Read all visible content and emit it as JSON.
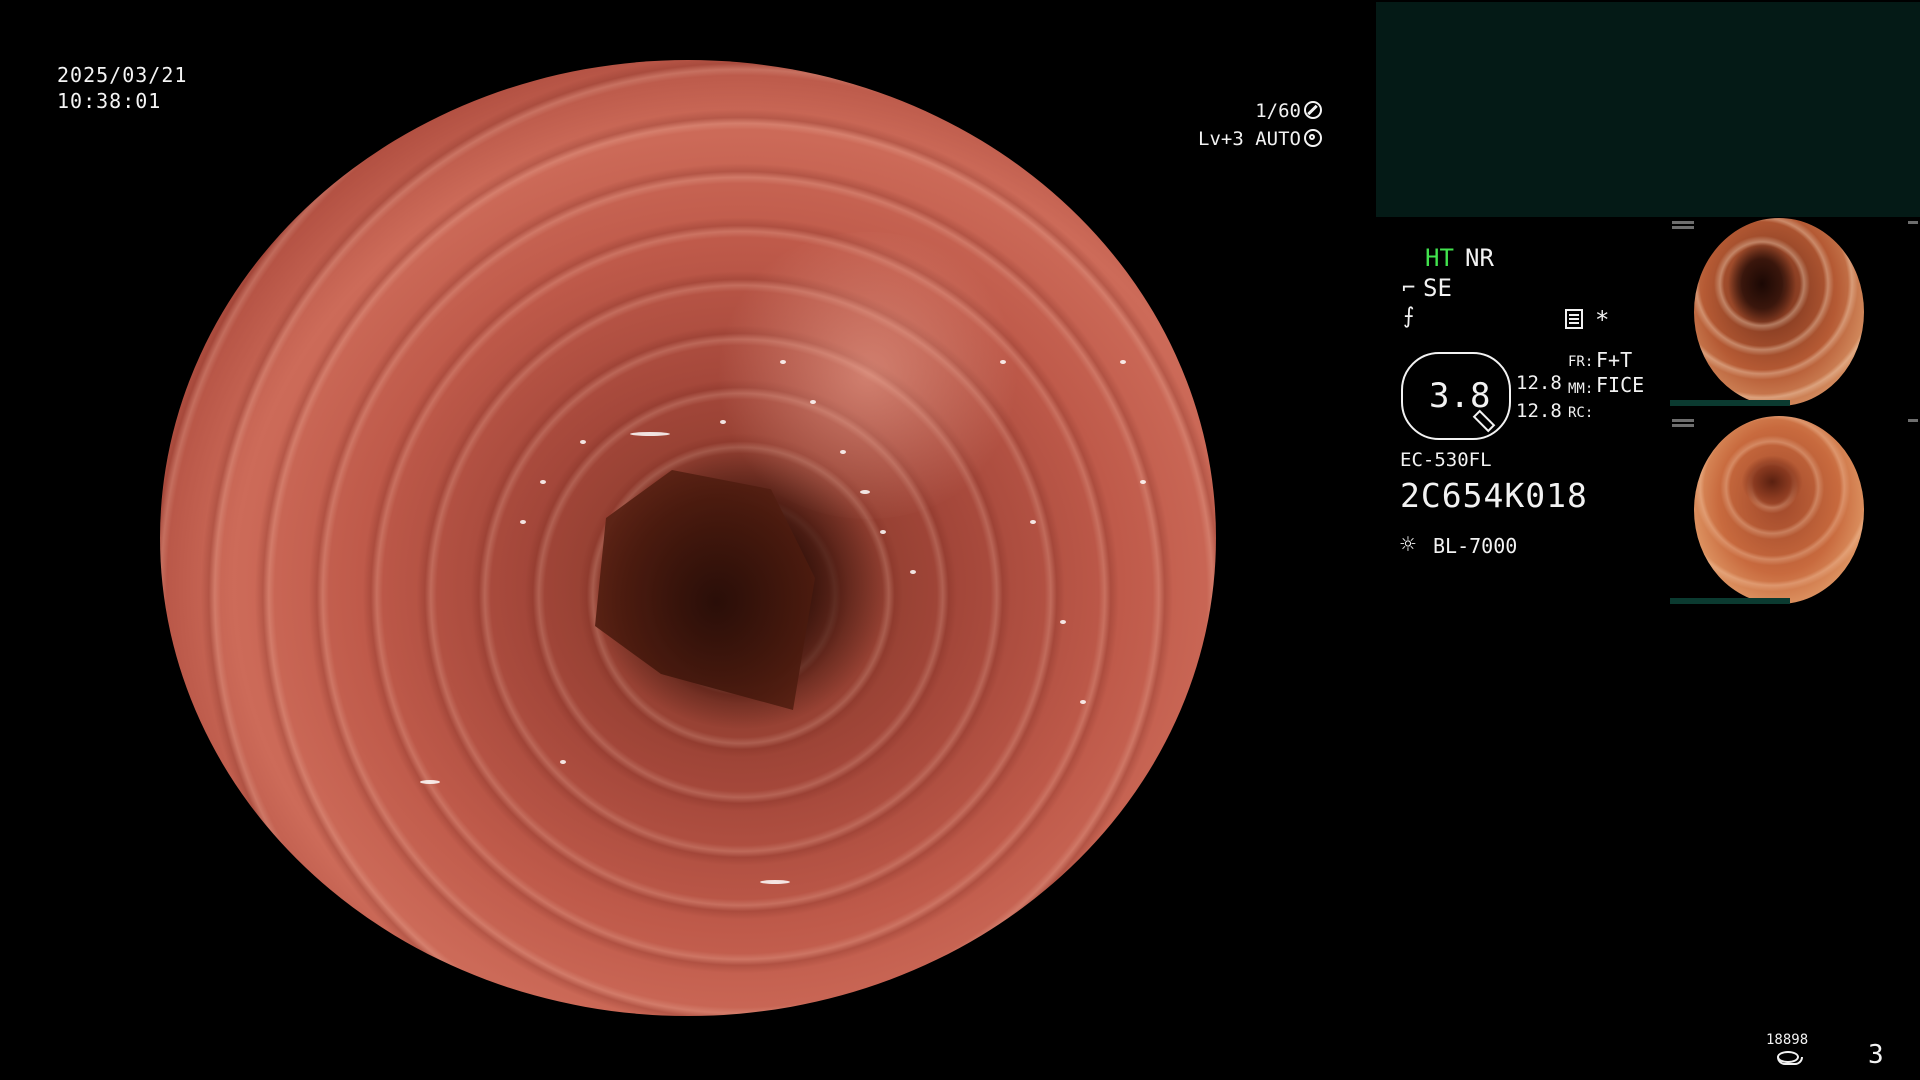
{
  "timestamp": {
    "date": "2025/03/21",
    "time": "10:38:01"
  },
  "exposure": {
    "shutter": "1/60",
    "gain": "Lv+3 AUTO",
    "shutter_icon": "aperture-icon",
    "gain_icon": "iris-icon"
  },
  "enhancement": {
    "ht": "HT",
    "nr": "NR",
    "se": "SE",
    "ht_color": "#42e34e"
  },
  "zoom": {
    "value": "3.8",
    "readout_1": "12.8",
    "readout_2": "12.8"
  },
  "modes": {
    "fr_label": "FR:",
    "fr_value": "F+T",
    "mm_label": "MM:",
    "mm_value": "FICE",
    "rc_label": "RC:",
    "asterisk": "*"
  },
  "scope": {
    "model": "EC-530FL",
    "serial": "2C654K018",
    "light_source": "BL-7000"
  },
  "counter": {
    "images": "18898",
    "page": "3"
  },
  "colors": {
    "background": "#000000",
    "top_box": "#041a16",
    "text": "#f2f2f2"
  }
}
